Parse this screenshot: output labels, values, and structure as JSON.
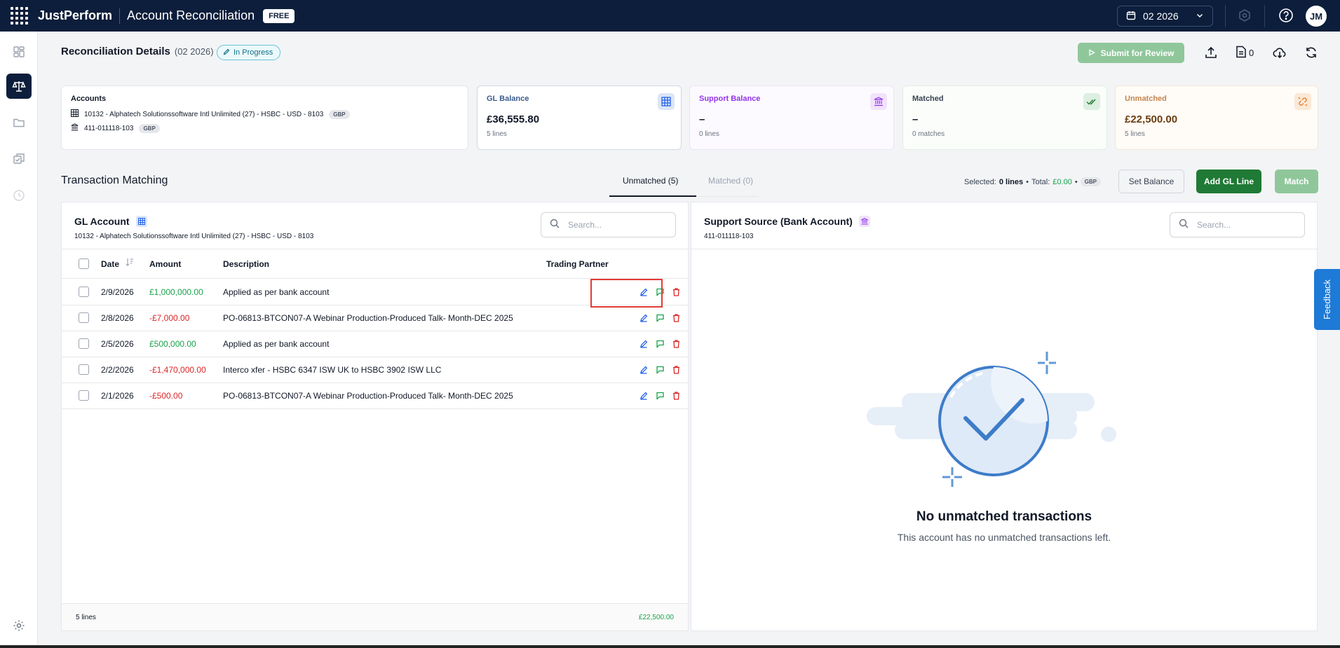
{
  "topbar": {
    "brand": "JustPerform",
    "app_title": "Account Reconciliation",
    "plan_badge": "FREE",
    "period": "02 2026",
    "user_initials": "JM"
  },
  "header": {
    "title": "Reconciliation Details",
    "period": "(02 2026)",
    "status": "In Progress",
    "submit_label": "Submit for Review",
    "doc_count": "0"
  },
  "cards": {
    "accounts": {
      "label": "Accounts",
      "lines": [
        {
          "text": "10132 - Alphatech Solutionssoftware Intl Unlimited (27) - HSBC - USD - 8103",
          "currency": "GBP"
        },
        {
          "text": "411-011118-103",
          "currency": "GBP"
        }
      ]
    },
    "gl_balance": {
      "label": "GL Balance",
      "value": "£36,555.80",
      "sub": "5 lines"
    },
    "support_balance": {
      "label": "Support Balance",
      "value": "–",
      "sub": "0 lines"
    },
    "matched": {
      "label": "Matched",
      "value": "–",
      "sub": "0 matches"
    },
    "unmatched": {
      "label": "Unmatched",
      "value": "£22,500.00",
      "sub": "5 lines"
    }
  },
  "matching": {
    "title": "Transaction Matching",
    "tabs": [
      {
        "label": "Unmatched (5)",
        "active": true
      },
      {
        "label": "Matched (0)",
        "active": false
      }
    ],
    "selected_label": "Selected:",
    "selected_value": "0 lines",
    "total_label": "Total:",
    "total_value": "£0.00",
    "total_currency": "GBP",
    "set_balance_label": "Set Balance",
    "add_gl_label": "Add GL Line",
    "match_label": "Match"
  },
  "gl_panel": {
    "title": "GL Account",
    "subtitle": "10132 - Alphatech Solutionssoftware Intl Unlimited (27) - HSBC - USD - 8103",
    "search_placeholder": "Search...",
    "columns": {
      "date": "Date",
      "amount": "Amount",
      "description": "Description",
      "trading_partner": "Trading Partner"
    },
    "rows": [
      {
        "date": "2/9/2026",
        "amount": "£1,000,000.00",
        "sign": "pos",
        "description": "Applied as per bank account"
      },
      {
        "date": "2/8/2026",
        "amount": "-£7,000.00",
        "sign": "neg",
        "description": "PO-06813-BTCON07-A Webinar Production-Produced Talk- Month-DEC 2025"
      },
      {
        "date": "2/5/2026",
        "amount": "£500,000.00",
        "sign": "pos",
        "description": "Applied as per bank account"
      },
      {
        "date": "2/2/2026",
        "amount": "-£1,470,000.00",
        "sign": "neg",
        "description": "Interco xfer - HSBC 6347 ISW UK to HSBC 3902 ISW LLC"
      },
      {
        "date": "2/1/2026",
        "amount": "-£500.00",
        "sign": "neg",
        "description": "PO-06813-BTCON07-A Webinar Production-Produced Talk- Month-DEC 2025"
      }
    ],
    "footer_lines": "5 lines",
    "footer_total": "£22,500.00"
  },
  "support_panel": {
    "title": "Support Source (Bank Account)",
    "subtitle": "411-011118-103",
    "search_placeholder": "Search...",
    "empty_title": "No unmatched transactions",
    "empty_sub": "This account has no unmatched transactions left."
  },
  "feedback_label": "Feedback",
  "colors": {
    "topbar": "#0c1e3b",
    "accent_green": "#1f7a35",
    "positive": "#16a34a",
    "negative": "#dc2626",
    "status_teal": "#0e6e86"
  },
  "icons": {
    "row_actions": [
      "edit-icon",
      "flag-icon",
      "delete-icon"
    ],
    "sidebar": [
      "dashboard-icon",
      "scale-icon",
      "folder-icon",
      "tasks-icon",
      "history-icon",
      "settings-icon"
    ]
  }
}
